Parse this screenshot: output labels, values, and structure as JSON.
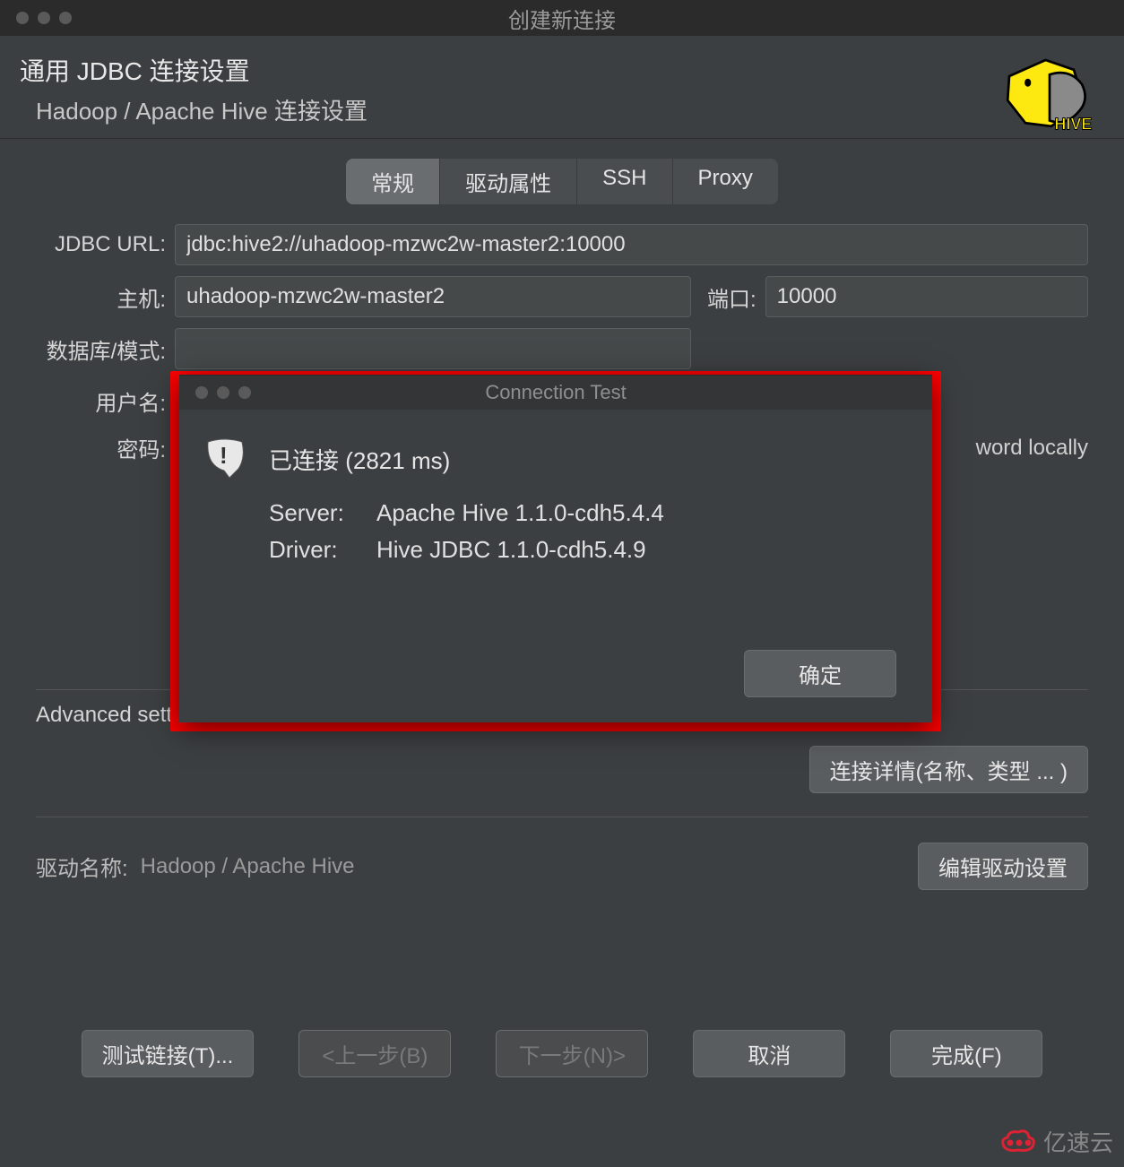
{
  "titlebar": {
    "title": "创建新连接"
  },
  "header": {
    "title": "通用 JDBC 连接设置",
    "subtitle": "Hadoop / Apache Hive 连接设置"
  },
  "tabs": {
    "general": "常规",
    "driver_props": "驱动属性",
    "ssh": "SSH",
    "proxy": "Proxy"
  },
  "form": {
    "jdbc_url_label": "JDBC URL:",
    "jdbc_url": "jdbc:hive2://uhadoop-mzwc2w-master2:10000",
    "host_label": "主机:",
    "host": "uhadoop-mzwc2w-master2",
    "port_label": "端口:",
    "port": "10000",
    "db_label": "数据库/模式:",
    "db": "",
    "user_label": "用户名:",
    "user": "",
    "pwd_label": "密码:",
    "pwd": "",
    "pwd_tail": "word locally"
  },
  "advanced": {
    "label": "Advanced settings:",
    "conn_details": "连接详情(名称、类型 ... )"
  },
  "driver": {
    "label": "驱动名称:",
    "value": "Hadoop / Apache Hive",
    "edit_button": "编辑驱动设置"
  },
  "bottom": {
    "test": "测试链接(T)...",
    "back": "<上一步(B)",
    "next": "下一步(N)>",
    "cancel": "取消",
    "finish": "完成(F)"
  },
  "modal": {
    "title": "Connection Test",
    "connected": "已连接 (2821 ms)",
    "server_label": "Server:",
    "server_value": "Apache Hive 1.1.0-cdh5.4.4",
    "driver_label": "Driver:",
    "driver_value": "Hive JDBC 1.1.0-cdh5.4.9",
    "ok": "确定"
  },
  "watermark": {
    "text": "亿速云"
  }
}
